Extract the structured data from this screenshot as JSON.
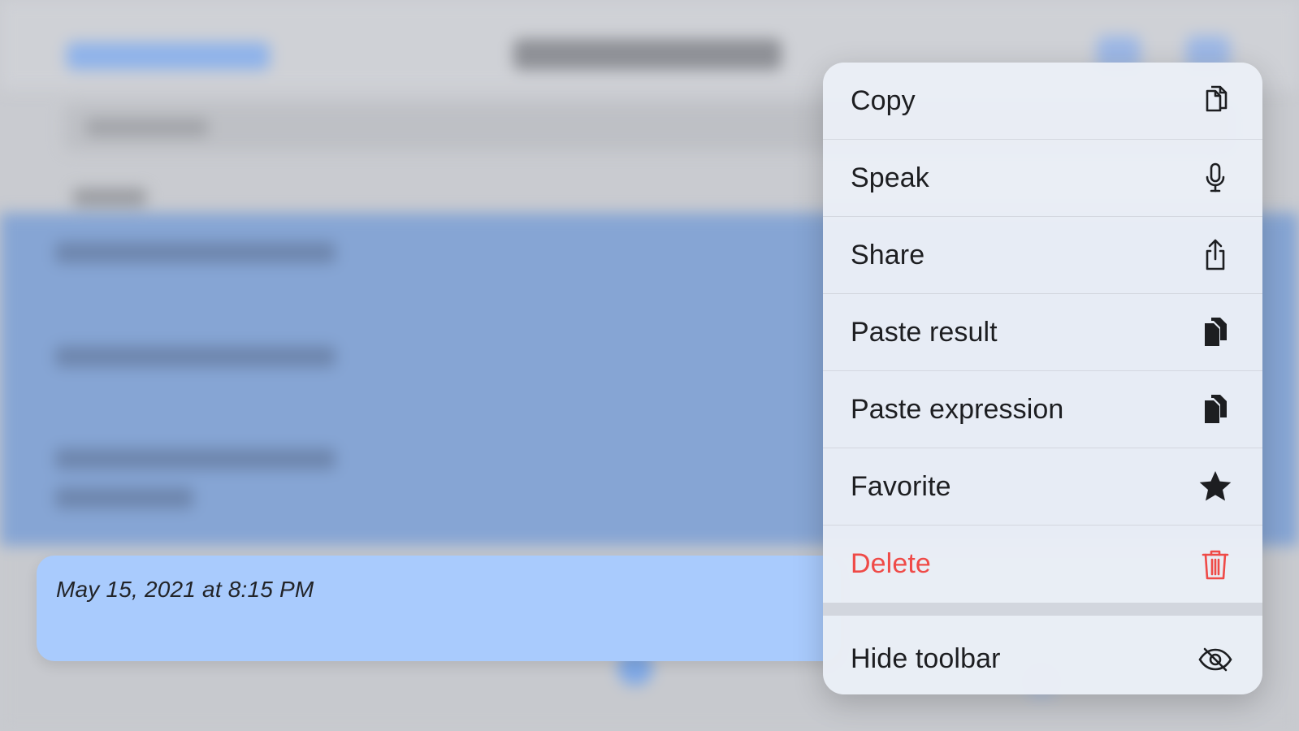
{
  "history_card": {
    "timestamp": "May 15, 2021 at 8:15 PM"
  },
  "context_menu": {
    "items": [
      {
        "label": "Copy",
        "icon": "copy-icon",
        "destructive": false
      },
      {
        "label": "Speak",
        "icon": "microphone-icon",
        "destructive": false
      },
      {
        "label": "Share",
        "icon": "share-icon",
        "destructive": false
      },
      {
        "label": "Paste result",
        "icon": "paste-icon",
        "destructive": false
      },
      {
        "label": "Paste expression",
        "icon": "paste-icon",
        "destructive": false
      },
      {
        "label": "Favorite",
        "icon": "star-icon",
        "destructive": false
      },
      {
        "label": "Delete",
        "icon": "trash-icon",
        "destructive": true
      }
    ],
    "secondary_items": [
      {
        "label": "Hide toolbar",
        "icon": "eye-icon"
      }
    ]
  },
  "colors": {
    "highlight_card": "#a9cbfd",
    "selected_rows": "#86a5d4",
    "destructive": "#ef4a47",
    "menu_background": "#eaeef6"
  }
}
